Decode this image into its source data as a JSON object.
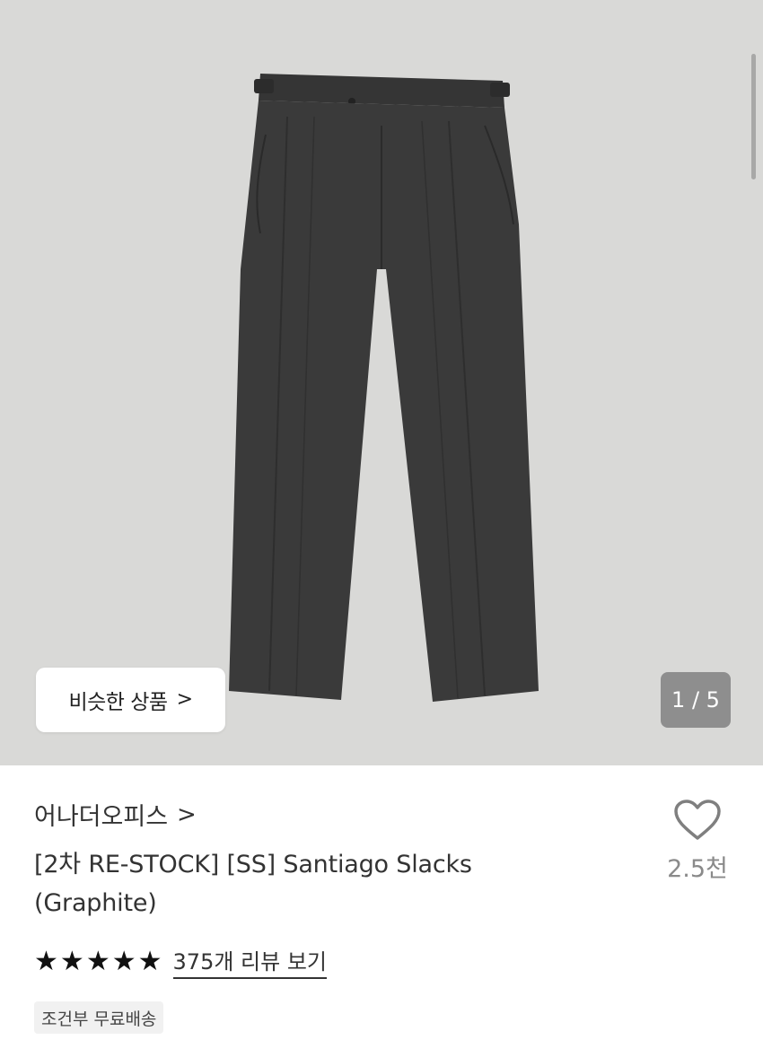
{
  "gallery": {
    "similar_label": "비슷한 상품",
    "similar_chevron": ">",
    "counter": "1 / 5"
  },
  "product": {
    "brand": "어나더오피스",
    "brand_chevron": ">",
    "title_line1": "[2차 RE-STOCK] [SS] Santiago Slacks",
    "title_line2": "(Graphite)",
    "like_count": "2.5천",
    "stars": [
      "★",
      "★",
      "★",
      "★",
      "★"
    ],
    "review_link": "375개 리뷰 보기",
    "shipping_badge": "조건부 무료배송"
  },
  "colors": {
    "hero_bg": "#d9d9d7",
    "pants": "#3a3a3a",
    "counter_bg": "#8e8e8e"
  },
  "icons": {
    "like": "heart-outline-icon",
    "chevron": "chevron-right-icon",
    "star": "star-filled-icon"
  }
}
